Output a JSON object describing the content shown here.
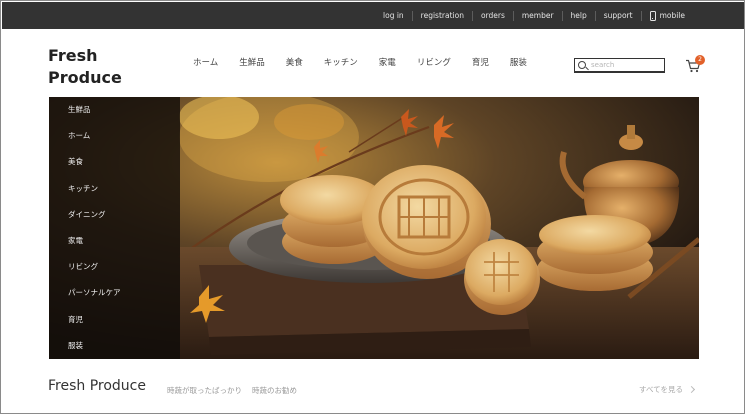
{
  "topbar": {
    "links": [
      "log in",
      "registration",
      "orders",
      "member",
      "help",
      "support"
    ],
    "mobile_label": "mobile"
  },
  "header": {
    "logo_line1": "Fresh",
    "logo_line2": "Produce",
    "nav": [
      "ホーム",
      "生鮮品",
      "美食",
      "キッチン",
      "家電",
      "リビング",
      "育児",
      "服装"
    ],
    "search_placeholder": "search",
    "cart_count": "2"
  },
  "hero": {
    "side_menu": [
      "生鮮品",
      "ホーム",
      "美食",
      "キッチン",
      "ダイニング",
      "家電",
      "リビング",
      "パーソナルケア",
      "育児",
      "服装"
    ],
    "banner_icon": "mooncake-photo",
    "accent_color": "#e2612a"
  },
  "section": {
    "title": "Fresh Produce",
    "subtitles": [
      "時蔬が取ったばっかり",
      "時蔬のお勧め"
    ],
    "see_all": "すべてを見る"
  }
}
